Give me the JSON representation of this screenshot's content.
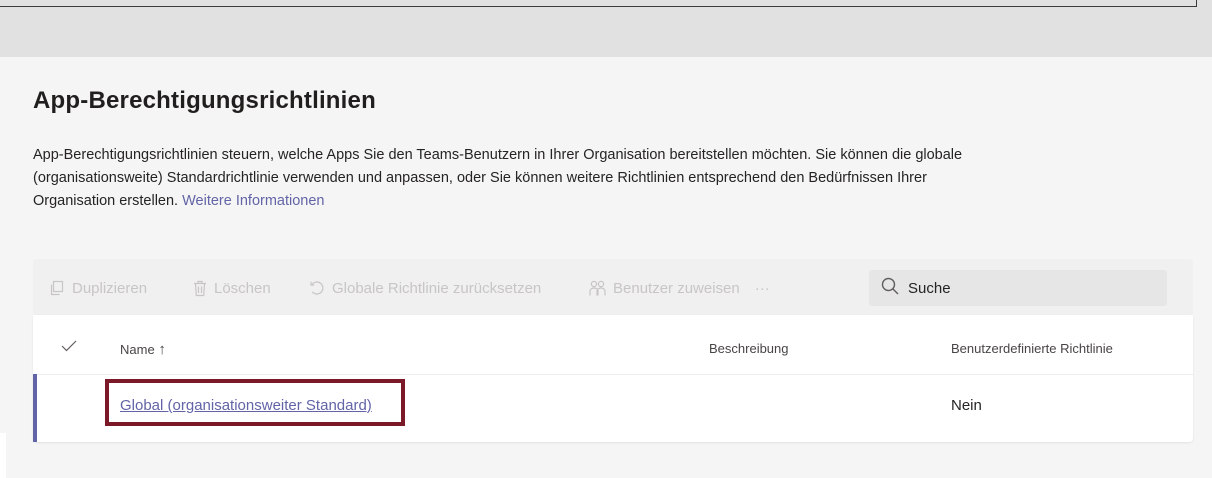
{
  "page": {
    "title": "App-Berechtigungsrichtlinien",
    "description": "App-Berechtigungsrichtlinien steuern, welche Apps Sie den Teams-Benutzern in Ihrer Organisation bereitstellen möchten. Sie können die globale (organisationsweite) Standardrichtlinie verwenden und anpassen, oder Sie können weitere Richtlinien entsprechend den Bedürfnissen Ihrer Organisation erstellen.",
    "learn_more": "Weitere Informationen"
  },
  "toolbar": {
    "duplicate": "Duplizieren",
    "delete": "Löschen",
    "reset": "Globale Richtlinie zurücksetzen",
    "assign": "Benutzer zuweisen",
    "more": "···",
    "search_placeholder": "Suche"
  },
  "table": {
    "columns": {
      "name": "Name",
      "sort_indicator": "↑",
      "description": "Beschreibung",
      "custom": "Benutzerdefinierte Richtlinie"
    },
    "rows": [
      {
        "name": "Global (organisationsweiter Standard)",
        "description": "",
        "custom": "Nein"
      }
    ]
  },
  "colors": {
    "accent": "#6264a7",
    "highlight": "#7b1928"
  }
}
